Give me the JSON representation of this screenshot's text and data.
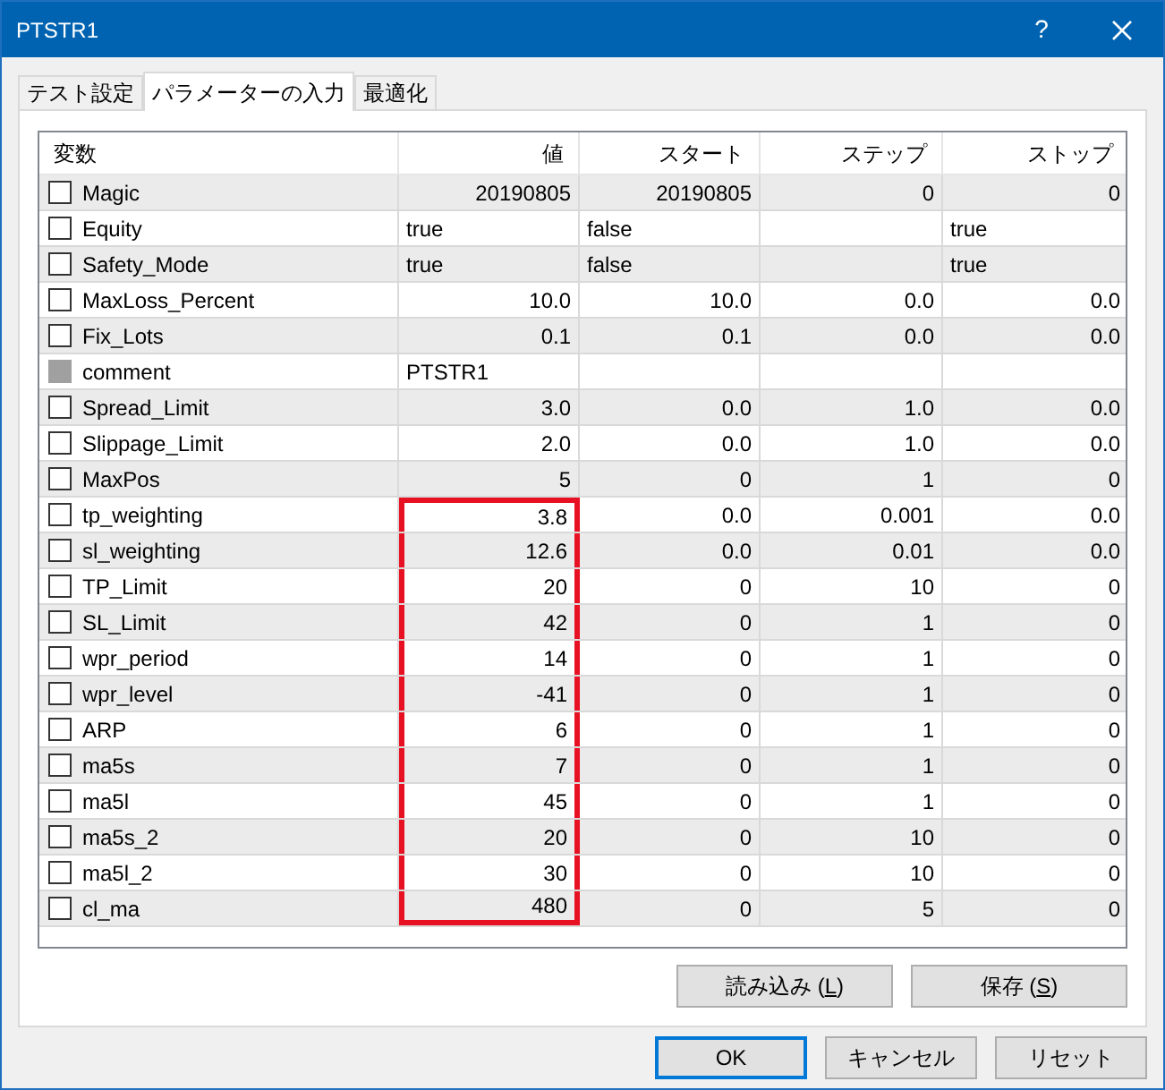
{
  "window": {
    "title": "PTSTR1",
    "help": "?"
  },
  "tabs": [
    {
      "label": "テスト設定",
      "selected": false
    },
    {
      "label": "パラメーターの入力",
      "selected": true
    },
    {
      "label": "最適化",
      "selected": false
    }
  ],
  "table": {
    "columns": [
      "変数",
      "値",
      "スタート",
      "ステップ",
      "ストップ"
    ],
    "rows": [
      {
        "name": "Magic",
        "checked": false,
        "disabled": false,
        "highlighted": false,
        "value": "20190805",
        "start": "20190805",
        "step": "0",
        "stop": "0",
        "kind": "number"
      },
      {
        "name": "Equity",
        "checked": false,
        "disabled": false,
        "highlighted": false,
        "value": "true",
        "start": "false",
        "stop": "true",
        "kind": "text"
      },
      {
        "name": "Safety_Mode",
        "checked": false,
        "disabled": false,
        "highlighted": false,
        "value": "true",
        "start": "false",
        "stop": "true",
        "kind": "text"
      },
      {
        "name": "MaxLoss_Percent",
        "checked": false,
        "disabled": false,
        "highlighted": false,
        "value": "10.0",
        "start": "10.0",
        "step": "0.0",
        "stop": "0.0",
        "kind": "number"
      },
      {
        "name": "Fix_Lots",
        "checked": false,
        "disabled": false,
        "highlighted": false,
        "value": "0.1",
        "start": "0.1",
        "step": "0.0",
        "stop": "0.0",
        "kind": "number"
      },
      {
        "name": "comment",
        "checked": false,
        "disabled": true,
        "highlighted": false,
        "value": "PTSTR1",
        "kind": "text"
      },
      {
        "name": "Spread_Limit",
        "checked": false,
        "disabled": false,
        "highlighted": false,
        "value": "3.0",
        "start": "0.0",
        "step": "1.0",
        "stop": "0.0",
        "kind": "number"
      },
      {
        "name": "Slippage_Limit",
        "checked": false,
        "disabled": false,
        "highlighted": false,
        "value": "2.0",
        "start": "0.0",
        "step": "1.0",
        "stop": "0.0",
        "kind": "number"
      },
      {
        "name": "MaxPos",
        "checked": false,
        "disabled": false,
        "highlighted": false,
        "value": "5",
        "start": "0",
        "step": "1",
        "stop": "0",
        "kind": "number"
      },
      {
        "name": "tp_weighting",
        "checked": false,
        "disabled": false,
        "highlighted": true,
        "value": "3.8",
        "start": "0.0",
        "step": "0.001",
        "stop": "0.0",
        "kind": "number"
      },
      {
        "name": "sl_weighting",
        "checked": false,
        "disabled": false,
        "highlighted": true,
        "value": "12.6",
        "start": "0.0",
        "step": "0.01",
        "stop": "0.0",
        "kind": "number"
      },
      {
        "name": "TP_Limit",
        "checked": false,
        "disabled": false,
        "highlighted": true,
        "value": "20",
        "start": "0",
        "step": "10",
        "stop": "0",
        "kind": "number"
      },
      {
        "name": "SL_Limit",
        "checked": false,
        "disabled": false,
        "highlighted": true,
        "value": "42",
        "start": "0",
        "step": "1",
        "stop": "0",
        "kind": "number"
      },
      {
        "name": "wpr_period",
        "checked": false,
        "disabled": false,
        "highlighted": true,
        "value": "14",
        "start": "0",
        "step": "1",
        "stop": "0",
        "kind": "number"
      },
      {
        "name": "wpr_level",
        "checked": false,
        "disabled": false,
        "highlighted": true,
        "value": "-41",
        "start": "0",
        "step": "1",
        "stop": "0",
        "kind": "number"
      },
      {
        "name": "ARP",
        "checked": false,
        "disabled": false,
        "highlighted": true,
        "value": "6",
        "start": "0",
        "step": "1",
        "stop": "0",
        "kind": "number"
      },
      {
        "name": "ma5s",
        "checked": false,
        "disabled": false,
        "highlighted": true,
        "value": "7",
        "start": "0",
        "step": "1",
        "stop": "0",
        "kind": "number"
      },
      {
        "name": "ma5l",
        "checked": false,
        "disabled": false,
        "highlighted": true,
        "value": "45",
        "start": "0",
        "step": "1",
        "stop": "0",
        "kind": "number"
      },
      {
        "name": "ma5s_2",
        "checked": false,
        "disabled": false,
        "highlighted": true,
        "value": "20",
        "start": "0",
        "step": "10",
        "stop": "0",
        "kind": "number"
      },
      {
        "name": "ma5l_2",
        "checked": false,
        "disabled": false,
        "highlighted": true,
        "value": "30",
        "start": "0",
        "step": "10",
        "stop": "0",
        "kind": "number"
      },
      {
        "name": "cl_ma",
        "checked": false,
        "disabled": false,
        "highlighted": true,
        "value": "480",
        "start": "0",
        "step": "5",
        "stop": "0",
        "kind": "number"
      }
    ]
  },
  "file_buttons": [
    {
      "before": "読み込み (",
      "accel": "L",
      "after": ")"
    },
    {
      "before": "保存 (",
      "accel": "S",
      "after": ")"
    }
  ],
  "dialog_buttons": [
    {
      "label": "OK",
      "default": true
    },
    {
      "label": "キャンセル",
      "default": false
    },
    {
      "label": "リセット",
      "default": false
    }
  ]
}
